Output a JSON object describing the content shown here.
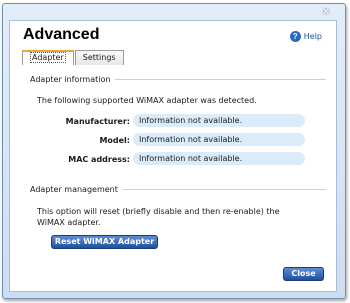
{
  "window": {
    "close_glyph": "×"
  },
  "header": {
    "title": "Advanced",
    "help_label": "Help",
    "help_icon": "?"
  },
  "tabs": [
    {
      "label": "Adapter",
      "active": true
    },
    {
      "label": "Settings",
      "active": false
    }
  ],
  "adapter_info": {
    "heading": "Adapter information",
    "detected_text": "The following supported WiMAX adapter was detected.",
    "fields": [
      {
        "label": "Manufacturer:",
        "value": "Information not available."
      },
      {
        "label": "Model:",
        "value": "Information not available."
      },
      {
        "label": "MAC address:",
        "value": "Information not available."
      }
    ]
  },
  "adapter_management": {
    "heading": "Adapter management",
    "description": "This option will reset (briefly disable and then re-enable) the WiMAX adapter.",
    "reset_button": "Reset WiMAX Adapter"
  },
  "footer": {
    "close_button": "Close"
  },
  "colors": {
    "accent": "#1f4e9e",
    "field_bg": "#dcebfa",
    "active_tab": "#f0a531"
  }
}
